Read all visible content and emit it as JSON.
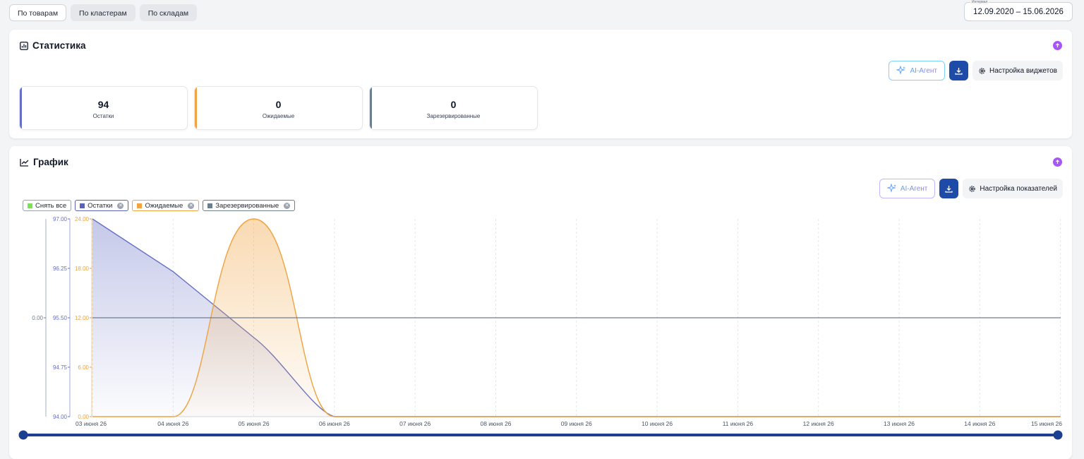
{
  "tabs": [
    {
      "label": "По товарам",
      "active": true
    },
    {
      "label": "По кластерам",
      "active": false
    },
    {
      "label": "По складам",
      "active": false
    }
  ],
  "interval": {
    "label": "Интервал",
    "value": "12.09.2020 – 15.06.2026"
  },
  "stats": {
    "title": "Статистика",
    "ai_label": "AI-Агент",
    "settings_label": "Настройка виджетов",
    "metrics": [
      {
        "value": "94",
        "label": "Остатки",
        "color": "#6670c4"
      },
      {
        "value": "0",
        "label": "Ожидаемые",
        "color": "#f0a340"
      },
      {
        "value": "0",
        "label": "Зарезервированные",
        "color": "#6b7f8f"
      }
    ]
  },
  "chart": {
    "title": "График",
    "ai_label": "AI-Агент",
    "settings_label": "Настройка показателей",
    "legend": [
      {
        "label": "Снять все",
        "color": "#7ee05a",
        "removable": false
      },
      {
        "label": "Остатки",
        "color": "#5b63b7",
        "removable": true
      },
      {
        "label": "Ожидаемые",
        "color": "#f0a340",
        "removable": true
      },
      {
        "label": "Зарезервированные",
        "color": "#6b7f8f",
        "removable": true
      }
    ]
  },
  "colors": {
    "accent": "#1e4aa8",
    "purple": "#a855f7"
  },
  "chart_data": {
    "type": "line",
    "x": [
      "03 июня 26",
      "04 июня 26",
      "05 июня 26",
      "06 июня 26",
      "07 июня 26",
      "08 июня 26",
      "09 июня 26",
      "10 июня 26",
      "11 июня 26",
      "12 июня 26",
      "13 июня 26",
      "14 июня 26",
      "15 июня 26"
    ],
    "axes": [
      {
        "series": "Зарезервированные",
        "ticks": [
          "0.00"
        ],
        "color": "#6b7f8f"
      },
      {
        "series": "Остатки",
        "ticks": [
          "97.00",
          "96.25",
          "95.50",
          "94.75",
          "94.00"
        ],
        "ylim": [
          94,
          97
        ],
        "color": "#6670c4"
      },
      {
        "series": "Ожидаемые",
        "ticks": [
          "24.00",
          "18.00",
          "12.00",
          "6.00",
          "0.00"
        ],
        "ylim": [
          0,
          24
        ],
        "color": "#f0a340"
      }
    ],
    "series": [
      {
        "name": "Остатки",
        "axis": 1,
        "color": "#6670c4",
        "values": [
          97,
          96.2,
          95.2,
          94,
          94,
          94,
          94,
          94,
          94,
          94,
          94,
          94,
          94
        ]
      },
      {
        "name": "Ожидаемые",
        "axis": 2,
        "color": "#f0a340",
        "values": [
          0,
          0,
          24,
          0,
          0,
          0,
          0,
          0,
          0,
          0,
          0,
          0,
          0
        ]
      },
      {
        "name": "Зарезервированные",
        "axis": 0,
        "color": "#6b7f8f",
        "values": [
          0,
          0,
          0,
          0,
          0,
          0,
          0,
          0,
          0,
          0,
          0,
          0,
          0
        ]
      }
    ],
    "grid": true
  }
}
